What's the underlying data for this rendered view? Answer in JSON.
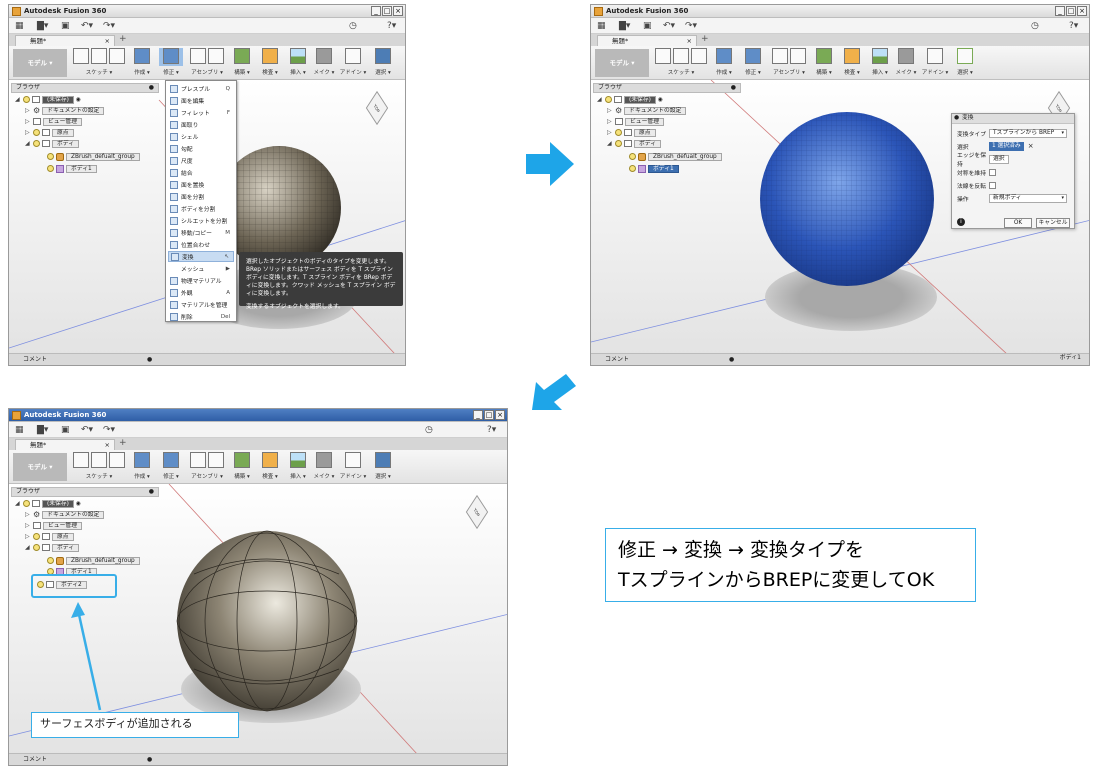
{
  "app_title": "Autodesk Fusion 360",
  "doc_tab": "無題*",
  "toolbar": {
    "model": "モデル ▾",
    "sketch": "スケッチ ▾",
    "create": "作成 ▾",
    "modify": "修正 ▾",
    "assemble": "アセンブリ ▾",
    "construct": "構築 ▾",
    "inspect": "検査 ▾",
    "insert": "挿入 ▾",
    "make": "メイク ▾",
    "addins": "アドイン ▾",
    "select": "選択 ▾"
  },
  "browser_label": "ブラウザ",
  "tree": {
    "root": "(未保存)",
    "doc_settings": "ドキュメントの設定",
    "views": "ビュー管理",
    "origin": "原点",
    "bodies": "ボディ",
    "group": "ZBrush_defualt_group",
    "body1": "ボディ1",
    "body2": "ボディ2"
  },
  "comment_label": "コメント",
  "status_body": "ボディ1",
  "modify_menu": [
    {
      "label": "プレスプル",
      "key": "Q"
    },
    {
      "label": "面を編集",
      "key": ""
    },
    {
      "label": "フィレット",
      "key": "F"
    },
    {
      "label": "面取り",
      "key": ""
    },
    {
      "label": "シェル",
      "key": ""
    },
    {
      "label": "勾配",
      "key": ""
    },
    {
      "label": "尺度",
      "key": ""
    },
    {
      "label": "結合",
      "key": ""
    },
    {
      "label": "面を置換",
      "key": ""
    },
    {
      "label": "面を分割",
      "key": ""
    },
    {
      "label": "ボディを分割",
      "key": ""
    },
    {
      "label": "シルエットを分割",
      "key": ""
    },
    {
      "label": "移動/コピー",
      "key": "M"
    },
    {
      "label": "位置合わせ",
      "key": ""
    },
    {
      "label": "変換",
      "key": ""
    },
    {
      "label": "メッシュ",
      "key": "▶"
    },
    {
      "label": "物理マテリアル",
      "key": ""
    },
    {
      "label": "外観",
      "key": "A"
    },
    {
      "label": "マテリアルを管理",
      "key": ""
    },
    {
      "label": "削除",
      "key": "Del"
    }
  ],
  "tooltip": {
    "line1": "選択したオブジェクトのボディのタイプを変更します。BRep ソリッドまたはサーフェス ボディを T スプライン ボディに変換します。T スプライン ボディを BRep ボディに変換します。クワッド メッシュを T スプライン ボディに変換します。",
    "line2": "変換するオブジェクトを選択します。"
  },
  "dialog": {
    "title": "変換",
    "type_label": "変換タイプ",
    "type_value": "Tスプラインから BREP",
    "select_label": "選択",
    "select_value": "1 選択済み",
    "edges_label": "エッジを保持",
    "edges_value": "選択",
    "hard_label": "対称を維持",
    "normal_label": "法線を反転",
    "op_label": "操作",
    "op_value": "新規ボディ",
    "ok": "OK",
    "cancel": "キャンセル"
  },
  "annotation_main": [
    "修正 → 変換 → 変換タイプを",
    "TスプラインからBREPに変更してOK"
  ],
  "annotation_surface": "サーフェスボディが追加される",
  "colors": {
    "accent": "#38aee8",
    "body_blue": "#2b55b8",
    "selected": "#3d6fb0"
  }
}
